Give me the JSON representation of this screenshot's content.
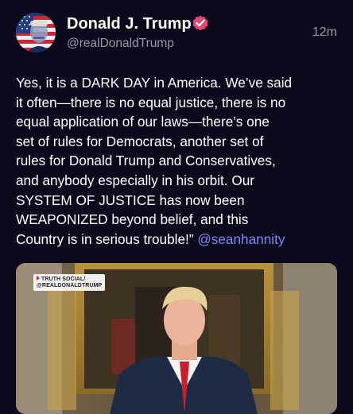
{
  "author": {
    "display_name": "Donald J. Trump",
    "handle": "@realDonaldTrump",
    "verified": true,
    "avatar_icon": "flag-portrait-avatar"
  },
  "post": {
    "timestamp": "12m",
    "text_lines": [
      "Yes, it is a DARK DAY in America. We’ve said",
      "it often—there is no equal justice, there is no",
      "equal application of our laws—there’s one",
      "set of rules for Democrats, another set of",
      "rules for Donald Trump and Conservatives,",
      "and anybody especially in his orbit. Our",
      "SYSTEM OF JUSTICE has now been",
      "WEAPONIZED beyond belief, and this",
      "Country is in serious trouble!” "
    ],
    "mention": "@seanhannity"
  },
  "media": {
    "watermark_line1": "TRUTH SOCIAL/",
    "watermark_line2": "@REALDONALDTRUMP"
  },
  "colors": {
    "background": "#0b0a1d",
    "text": "#ffffff",
    "secondary_text": "#9a98ae",
    "mention": "#7f86ff",
    "verified_badge": "#e0466f"
  }
}
